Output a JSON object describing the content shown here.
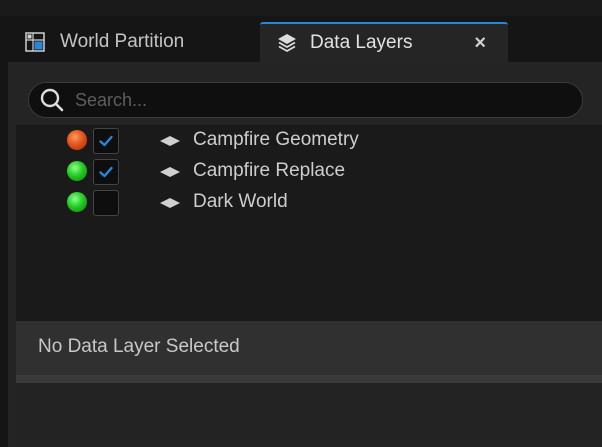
{
  "tabs": [
    {
      "label": "World Partition",
      "icon": "world-partition-icon",
      "active": false
    },
    {
      "label": "Data Layers",
      "icon": "layers-icon",
      "active": true,
      "close_label": "×"
    }
  ],
  "search": {
    "placeholder": "Search...",
    "value": ""
  },
  "layers": [
    {
      "name": "Campfire Geometry",
      "status": "orange",
      "checked": true
    },
    {
      "name": "Campfire Replace",
      "status": "green",
      "checked": true
    },
    {
      "name": "Dark World",
      "status": "green",
      "checked": false
    }
  ],
  "details": {
    "empty_label": "No Data Layer Selected"
  },
  "colors": {
    "accent": "#2a86d8",
    "status_orange": "#e2541d",
    "status_green": "#22cc22",
    "check": "#2a86d8"
  }
}
